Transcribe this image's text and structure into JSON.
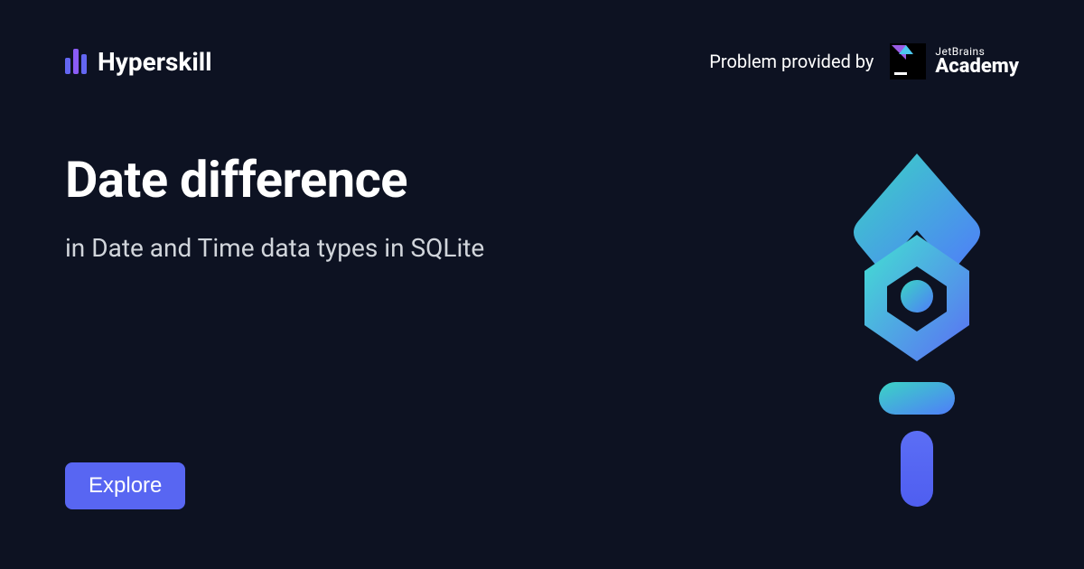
{
  "header": {
    "brand_name": "Hyperskill",
    "provided_by_label": "Problem provided by",
    "partner_line1": "JetBrains",
    "partner_line2": "Academy"
  },
  "main": {
    "title": "Date difference",
    "subtitle": "in Date and Time data types in SQLite"
  },
  "cta": {
    "explore_label": "Explore"
  }
}
